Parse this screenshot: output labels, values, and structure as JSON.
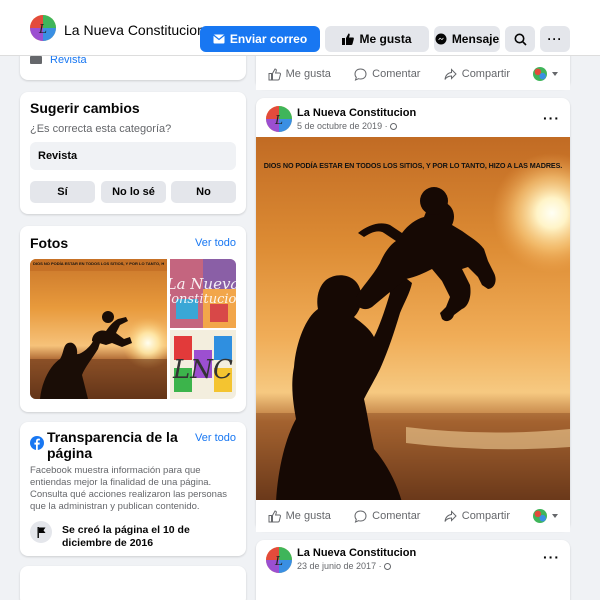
{
  "header": {
    "page_name": "La Nueva Constitucion",
    "email_label": "Enviar correo",
    "like_label": "Me gusta",
    "message_label": "Mensaje"
  },
  "sidebar": {
    "category_link": "Revista",
    "suggest": {
      "title": "Sugerir cambios",
      "question": "¿Es correcta esta categoría?",
      "category_value": "Revista",
      "options": [
        "Sí",
        "No lo sé",
        "No"
      ]
    },
    "photos": {
      "title": "Fotos",
      "see_all": "Ver todo",
      "thumb_quote": "DIOS NO PODÍA ESTAR EN TODOS LOS SITIOS, Y POR LO TANTO, HIZO A LAS MADRES."
    },
    "transparency": {
      "title": "Transparencia de la página",
      "see_all": "Ver todo",
      "description": "Facebook muestra información para que entiendas mejor la finalidad de una página. Consulta qué acciones realizaron las personas que la administran y publican contenido.",
      "created": "Se creó la página el 10 de diciembre de 2016"
    }
  },
  "actions": {
    "like": "Me gusta",
    "comment": "Comentar",
    "share": "Compartir"
  },
  "posts": [
    {
      "author": "La Nueva Constitucion",
      "date": "5 de octubre de 2019 · ",
      "image_text": "DIOS NO PODÍA ESTAR EN TODOS LOS SITIOS, Y POR LO TANTO, HIZO A LAS MADRES."
    },
    {
      "author": "La Nueva Constitucion",
      "date": "23 de junio de 2017 · "
    }
  ],
  "colors": {
    "accent": "#1877f2",
    "background": "#f0f2f5",
    "button_gray": "#e4e6eb",
    "muted_text": "#65676b"
  }
}
